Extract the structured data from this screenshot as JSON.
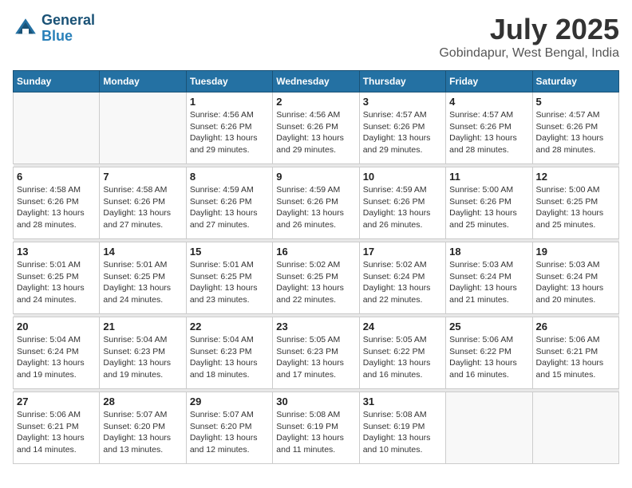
{
  "header": {
    "logo_line1": "General",
    "logo_line2": "Blue",
    "month_year": "July 2025",
    "location": "Gobindapur, West Bengal, India"
  },
  "weekdays": [
    "Sunday",
    "Monday",
    "Tuesday",
    "Wednesday",
    "Thursday",
    "Friday",
    "Saturday"
  ],
  "weeks": [
    [
      {
        "day": "",
        "sunrise": "",
        "sunset": "",
        "daylight": ""
      },
      {
        "day": "",
        "sunrise": "",
        "sunset": "",
        "daylight": ""
      },
      {
        "day": "1",
        "sunrise": "Sunrise: 4:56 AM",
        "sunset": "Sunset: 6:26 PM",
        "daylight": "Daylight: 13 hours and 29 minutes."
      },
      {
        "day": "2",
        "sunrise": "Sunrise: 4:56 AM",
        "sunset": "Sunset: 6:26 PM",
        "daylight": "Daylight: 13 hours and 29 minutes."
      },
      {
        "day": "3",
        "sunrise": "Sunrise: 4:57 AM",
        "sunset": "Sunset: 6:26 PM",
        "daylight": "Daylight: 13 hours and 29 minutes."
      },
      {
        "day": "4",
        "sunrise": "Sunrise: 4:57 AM",
        "sunset": "Sunset: 6:26 PM",
        "daylight": "Daylight: 13 hours and 28 minutes."
      },
      {
        "day": "5",
        "sunrise": "Sunrise: 4:57 AM",
        "sunset": "Sunset: 6:26 PM",
        "daylight": "Daylight: 13 hours and 28 minutes."
      }
    ],
    [
      {
        "day": "6",
        "sunrise": "Sunrise: 4:58 AM",
        "sunset": "Sunset: 6:26 PM",
        "daylight": "Daylight: 13 hours and 28 minutes."
      },
      {
        "day": "7",
        "sunrise": "Sunrise: 4:58 AM",
        "sunset": "Sunset: 6:26 PM",
        "daylight": "Daylight: 13 hours and 27 minutes."
      },
      {
        "day": "8",
        "sunrise": "Sunrise: 4:59 AM",
        "sunset": "Sunset: 6:26 PM",
        "daylight": "Daylight: 13 hours and 27 minutes."
      },
      {
        "day": "9",
        "sunrise": "Sunrise: 4:59 AM",
        "sunset": "Sunset: 6:26 PM",
        "daylight": "Daylight: 13 hours and 26 minutes."
      },
      {
        "day": "10",
        "sunrise": "Sunrise: 4:59 AM",
        "sunset": "Sunset: 6:26 PM",
        "daylight": "Daylight: 13 hours and 26 minutes."
      },
      {
        "day": "11",
        "sunrise": "Sunrise: 5:00 AM",
        "sunset": "Sunset: 6:26 PM",
        "daylight": "Daylight: 13 hours and 25 minutes."
      },
      {
        "day": "12",
        "sunrise": "Sunrise: 5:00 AM",
        "sunset": "Sunset: 6:25 PM",
        "daylight": "Daylight: 13 hours and 25 minutes."
      }
    ],
    [
      {
        "day": "13",
        "sunrise": "Sunrise: 5:01 AM",
        "sunset": "Sunset: 6:25 PM",
        "daylight": "Daylight: 13 hours and 24 minutes."
      },
      {
        "day": "14",
        "sunrise": "Sunrise: 5:01 AM",
        "sunset": "Sunset: 6:25 PM",
        "daylight": "Daylight: 13 hours and 24 minutes."
      },
      {
        "day": "15",
        "sunrise": "Sunrise: 5:01 AM",
        "sunset": "Sunset: 6:25 PM",
        "daylight": "Daylight: 13 hours and 23 minutes."
      },
      {
        "day": "16",
        "sunrise": "Sunrise: 5:02 AM",
        "sunset": "Sunset: 6:25 PM",
        "daylight": "Daylight: 13 hours and 22 minutes."
      },
      {
        "day": "17",
        "sunrise": "Sunrise: 5:02 AM",
        "sunset": "Sunset: 6:24 PM",
        "daylight": "Daylight: 13 hours and 22 minutes."
      },
      {
        "day": "18",
        "sunrise": "Sunrise: 5:03 AM",
        "sunset": "Sunset: 6:24 PM",
        "daylight": "Daylight: 13 hours and 21 minutes."
      },
      {
        "day": "19",
        "sunrise": "Sunrise: 5:03 AM",
        "sunset": "Sunset: 6:24 PM",
        "daylight": "Daylight: 13 hours and 20 minutes."
      }
    ],
    [
      {
        "day": "20",
        "sunrise": "Sunrise: 5:04 AM",
        "sunset": "Sunset: 6:24 PM",
        "daylight": "Daylight: 13 hours and 19 minutes."
      },
      {
        "day": "21",
        "sunrise": "Sunrise: 5:04 AM",
        "sunset": "Sunset: 6:23 PM",
        "daylight": "Daylight: 13 hours and 19 minutes."
      },
      {
        "day": "22",
        "sunrise": "Sunrise: 5:04 AM",
        "sunset": "Sunset: 6:23 PM",
        "daylight": "Daylight: 13 hours and 18 minutes."
      },
      {
        "day": "23",
        "sunrise": "Sunrise: 5:05 AM",
        "sunset": "Sunset: 6:23 PM",
        "daylight": "Daylight: 13 hours and 17 minutes."
      },
      {
        "day": "24",
        "sunrise": "Sunrise: 5:05 AM",
        "sunset": "Sunset: 6:22 PM",
        "daylight": "Daylight: 13 hours and 16 minutes."
      },
      {
        "day": "25",
        "sunrise": "Sunrise: 5:06 AM",
        "sunset": "Sunset: 6:22 PM",
        "daylight": "Daylight: 13 hours and 16 minutes."
      },
      {
        "day": "26",
        "sunrise": "Sunrise: 5:06 AM",
        "sunset": "Sunset: 6:21 PM",
        "daylight": "Daylight: 13 hours and 15 minutes."
      }
    ],
    [
      {
        "day": "27",
        "sunrise": "Sunrise: 5:06 AM",
        "sunset": "Sunset: 6:21 PM",
        "daylight": "Daylight: 13 hours and 14 minutes."
      },
      {
        "day": "28",
        "sunrise": "Sunrise: 5:07 AM",
        "sunset": "Sunset: 6:20 PM",
        "daylight": "Daylight: 13 hours and 13 minutes."
      },
      {
        "day": "29",
        "sunrise": "Sunrise: 5:07 AM",
        "sunset": "Sunset: 6:20 PM",
        "daylight": "Daylight: 13 hours and 12 minutes."
      },
      {
        "day": "30",
        "sunrise": "Sunrise: 5:08 AM",
        "sunset": "Sunset: 6:19 PM",
        "daylight": "Daylight: 13 hours and 11 minutes."
      },
      {
        "day": "31",
        "sunrise": "Sunrise: 5:08 AM",
        "sunset": "Sunset: 6:19 PM",
        "daylight": "Daylight: 13 hours and 10 minutes."
      },
      {
        "day": "",
        "sunrise": "",
        "sunset": "",
        "daylight": ""
      },
      {
        "day": "",
        "sunrise": "",
        "sunset": "",
        "daylight": ""
      }
    ]
  ]
}
